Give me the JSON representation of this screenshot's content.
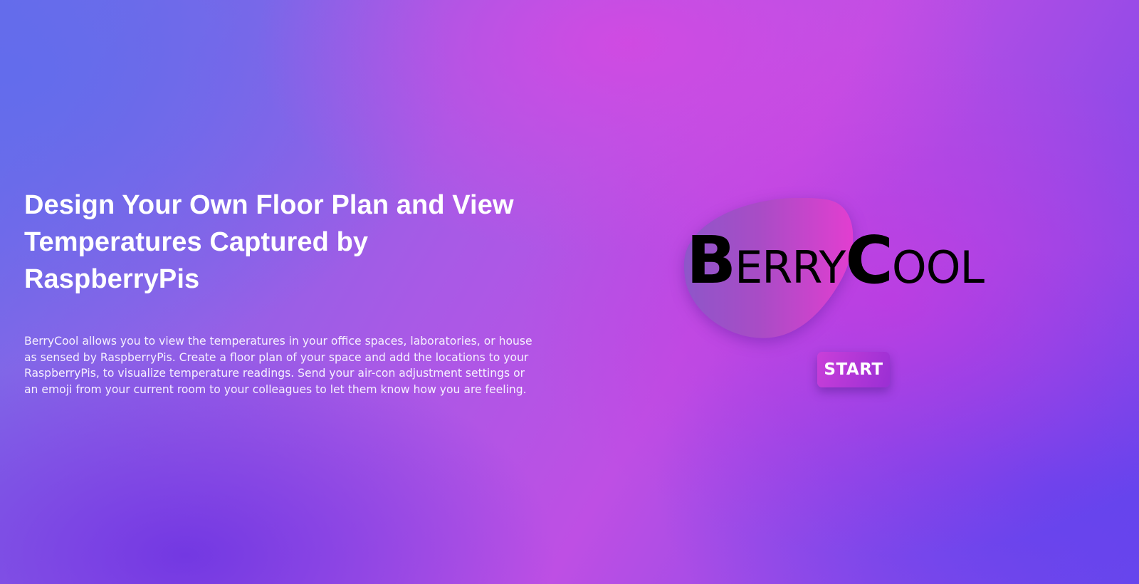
{
  "hero": {
    "headline": "Design Your Own Floor Plan and View Temperatures Captured by RaspberryPis",
    "description": "BerryCool allows you to view the temperatures in your office spaces, laboratories, or house as sensed by RaspberryPis. Create a floor plan of your space and add the locations to your RaspberryPis, to visualize temperature readings. Send your air-con adjustment settings or an emoji from your current room to your colleagues to let them know how you are feeling."
  },
  "logo": {
    "initial_1": "B",
    "rest_1": "ERRY",
    "initial_2": "C",
    "rest_2": "OOL",
    "blob_color_start": "#8e56c9",
    "blob_color_end": "#e23ed0"
  },
  "start_button": {
    "label": "START"
  },
  "colors": {
    "text": "#ffffff",
    "button_start": "#c93fd9",
    "button_end": "#9a2fd4"
  }
}
